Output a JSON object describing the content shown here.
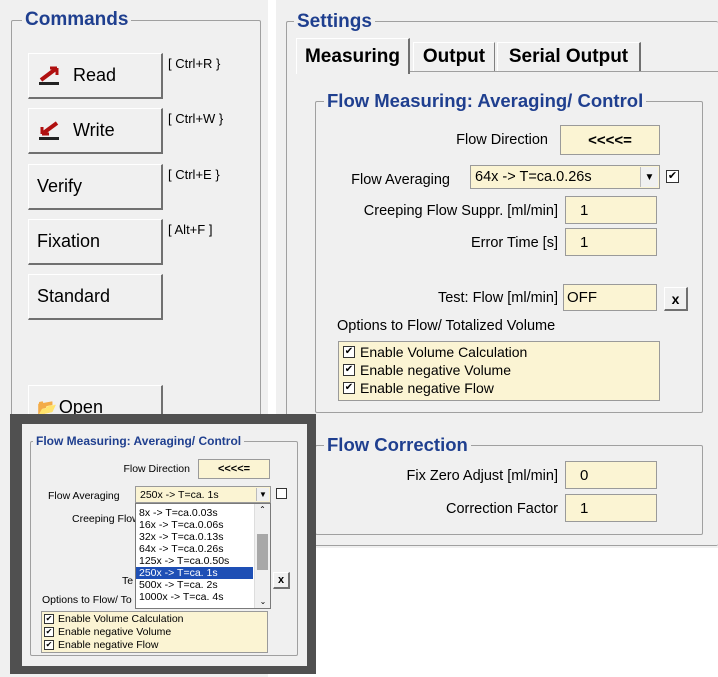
{
  "commands": {
    "title": "Commands",
    "buttons": [
      {
        "label": "Read",
        "shortcut": "[ Ctrl+R }"
      },
      {
        "label": "Write",
        "shortcut": "[ Ctrl+W }"
      },
      {
        "label": "Verify",
        "shortcut": "[ Ctrl+E }"
      },
      {
        "label": "Fixation",
        "shortcut": "[ Alt+F ]"
      },
      {
        "label": "Standard",
        "shortcut": ""
      }
    ],
    "open_label": "Open"
  },
  "settings": {
    "title": "Settings",
    "tabs": [
      "Measuring",
      "Output",
      "Serial Output"
    ],
    "active_tab": "Measuring",
    "flow_group": {
      "title": "Flow Measuring: Averaging/ Control",
      "flow_direction_label": "Flow Direction",
      "flow_direction_value": "<<<<=",
      "flow_averaging_label": "Flow Averaging",
      "flow_averaging_value": "64x -> T=ca.0.26s",
      "flow_averaging_checked": true,
      "creeping_label": "Creeping Flow Suppr. [ml/min]",
      "creeping_value": "1",
      "error_time_label": "Error Time [s]",
      "error_time_value": "1",
      "test_flow_label": "Test: Flow [ml/min]",
      "test_flow_value": "OFF",
      "test_flow_button": "x",
      "options_label": "Options to Flow/ Totalized Volume",
      "options": [
        {
          "label": "Enable Volume Calculation",
          "checked": true
        },
        {
          "label": "Enable negative Volume",
          "checked": true
        },
        {
          "label": "Enable negative Flow",
          "checked": true
        }
      ]
    },
    "correction_group": {
      "title": "Flow Correction",
      "fix_zero_label": "Fix Zero Adjust [ml/min]",
      "fix_zero_value": "0",
      "correction_label": "Correction Factor",
      "correction_value": "1"
    }
  },
  "inset": {
    "title": "Flow Measuring: Averaging/ Control",
    "flow_direction_label": "Flow Direction",
    "flow_direction_value": "<<<<=",
    "flow_averaging_label": "Flow Averaging",
    "flow_averaging_value": "250x -> T=ca. 1s",
    "creeping_label_partial": "Creeping Flow",
    "test_label_partial": "Te",
    "options_label_partial": "Options to Flow/ To",
    "test_button": "x",
    "dropdown_options": [
      "8x -> T=ca.0.03s",
      "16x -> T=ca.0.06s",
      "32x -> T=ca.0.13s",
      "64x -> T=ca.0.26s",
      "125x -> T=ca.0.50s",
      "250x -> T=ca. 1s",
      "500x -> T=ca. 2s",
      "1000x -> T=ca. 4s"
    ],
    "selected_index": 5,
    "options": [
      {
        "label": "Enable Volume Calculation",
        "checked": true
      },
      {
        "label": "Enable negative Volume",
        "checked": true
      },
      {
        "label": "Enable negative Flow",
        "checked": true
      }
    ]
  }
}
